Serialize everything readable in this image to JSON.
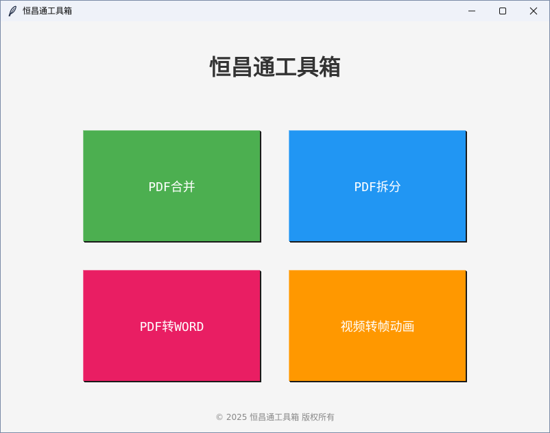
{
  "window": {
    "title": "恒昌通工具箱",
    "icon": "feather-icon",
    "controls": {
      "minimize": "minimize-icon",
      "maximize": "maximize-icon",
      "close": "close-icon"
    }
  },
  "main": {
    "title": "恒昌通工具箱",
    "buttons": [
      {
        "label": "PDF合并",
        "color": "#4caf50"
      },
      {
        "label": "PDF拆分",
        "color": "#2196f3"
      },
      {
        "label": "PDF转WORD",
        "color": "#e91e63"
      },
      {
        "label": "视频转帧动画",
        "color": "#ff9800"
      }
    ]
  },
  "footer": {
    "text": "© 2025 恒昌通工具箱 版权所有"
  }
}
